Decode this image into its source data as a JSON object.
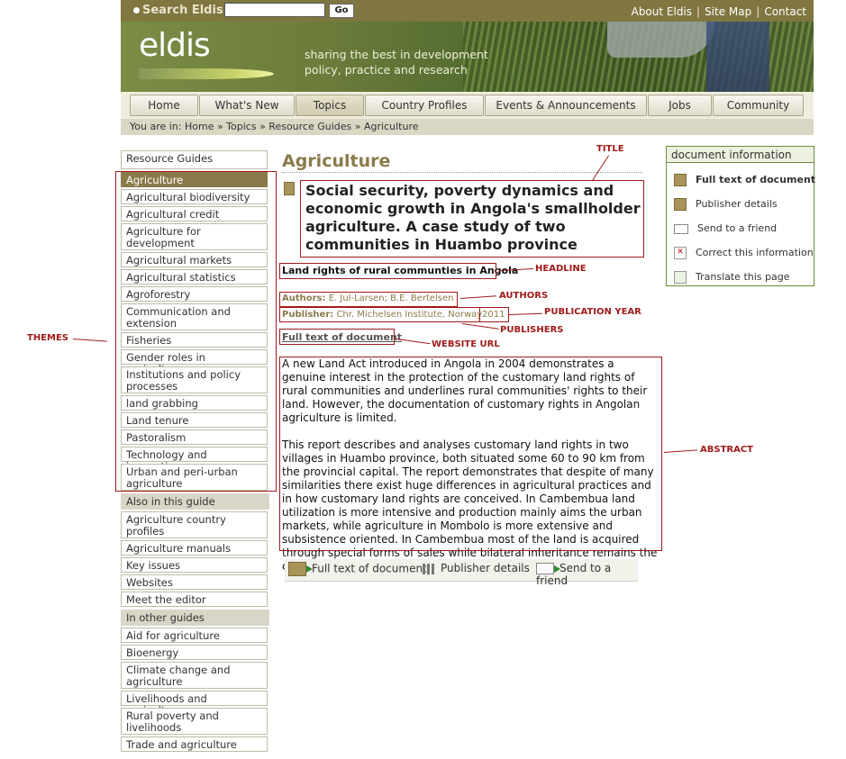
{
  "header": {
    "search_label": "Search Eldis",
    "search_value": "",
    "go_label": "Go",
    "links": [
      "About Eldis",
      "Site Map",
      "Contact"
    ]
  },
  "banner": {
    "logo": "eldis",
    "tagline_line1": "sharing the best in development",
    "tagline_line2": "policy, practice and research"
  },
  "nav": {
    "tabs": [
      "Home",
      "What's New",
      "Topics",
      "Country Profiles",
      "Events & Announcements",
      "Jobs",
      "Community"
    ],
    "active": "Topics"
  },
  "breadcrumb": "You are in: Home » Topics » Resource Guides » Agriculture",
  "sidebar": {
    "top": "Resource Guides",
    "themes": [
      "Agriculture",
      "Agricultural biodiversity",
      "Agricultural credit",
      "Agriculture for development",
      "Agricultural markets",
      "Agricultural statistics",
      "Agroforestry",
      "Communication and extension",
      "Fisheries",
      "Gender roles in agriculture",
      "Institutions and policy processes",
      "land grabbing",
      "Land tenure",
      "Pastoralism",
      "Technology and innovation",
      "Urban and peri-urban agriculture"
    ],
    "also_head": "Also in this guide",
    "also": [
      "Agriculture country profiles",
      "Agriculture manuals",
      "Key issues",
      "Websites",
      "Meet the editor"
    ],
    "other_head": "In other guides",
    "other": [
      "Aid for agriculture",
      "Bioenergy",
      "Climate change and agriculture",
      "Livelihoods and agriculture",
      "Rural poverty and livelihoods",
      "Trade and agriculture"
    ]
  },
  "main": {
    "page_title": "Agriculture",
    "doc_title": "Social security, poverty dynamics and economic growth in Angola's smallholder agriculture. A case study of two communities in Huambo province",
    "headline": "Land rights of rural communties in Angola",
    "authors_label": "Authors:",
    "authors": "E. Jul-Larsen; B.E. Bertelsen",
    "publisher_label": "Publisher:",
    "publisher": "Chr. Michelsen Institute, Norway",
    "year": "2011",
    "full_text_link": "Full text of document",
    "abstract_p1": "A new Land Act introduced in Angola in 2004 demonstrates a genuine interest in the protection of the customary land rights of rural communities and underlines rural communities' rights to their land. However, the documentation of customary rights in Angolan agriculture is limited.",
    "abstract_p2": "This report describes and analyses customary land rights in two villages in Huambo province, both situated some 60 to 90 km from the provincial capital. The report demonstrates that despite of many similarities there exist huge differences in agricultural practices and in how customary land rights are conceived. In Cambembua land utilization is more intensive and production mainly aims the urban markets, while agriculture in Mombolo is more extensive and subsistence oriented. In Cambembua most of the land is acquired through special forms of sales while bilateral inheritance remains the common practice in Mombolo. [Abstract from CMI website]",
    "actions": [
      "Full text of document",
      "Publisher details",
      "Send to a friend"
    ]
  },
  "docinfo": {
    "head": "document information",
    "items": [
      "Full text of document",
      "Publisher details",
      "Send to a friend",
      "Correct this information",
      "Translate this page"
    ]
  },
  "annotations": {
    "title": "TITLE",
    "headline": "HEADLINE",
    "authors": "AUTHORS",
    "pub_year": "PUBLICATION YEAR",
    "publishers": "PUBLISHERS",
    "website_url": "WEBSITE URL",
    "abstract": "ABSTRACT",
    "themes": "THEMES"
  },
  "colors": {
    "header_bg": "#807640",
    "accent_text": "#8a7a4a",
    "annotation_red": "#a01a1a",
    "docinfo_border": "#6b8d3e"
  }
}
